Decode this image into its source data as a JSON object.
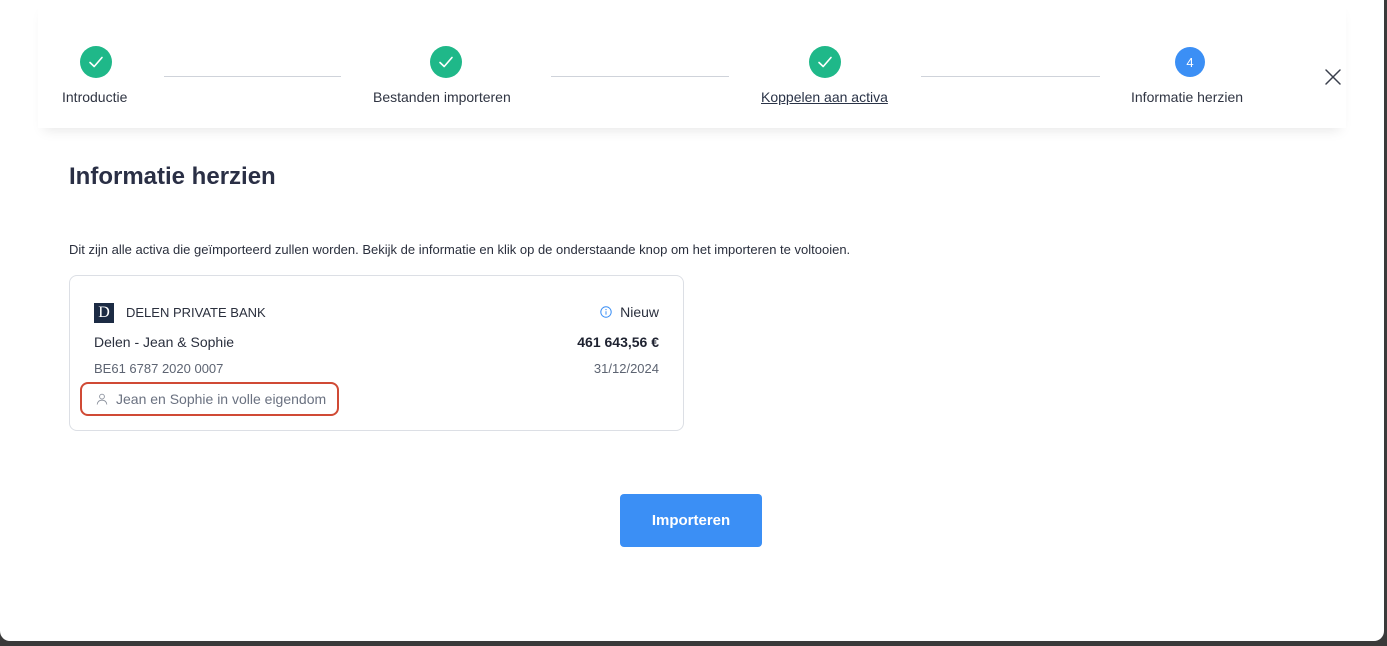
{
  "stepper": {
    "steps": [
      {
        "label": "Introductie",
        "status": "done"
      },
      {
        "label": "Bestanden importeren",
        "status": "done"
      },
      {
        "label": "Koppelen aan activa",
        "status": "done"
      },
      {
        "label": "Informatie herzien",
        "status": "active",
        "number": "4"
      }
    ],
    "close_icon": "close-icon"
  },
  "page": {
    "title": "Informatie herzien",
    "description": "Dit zijn alle activa die geïmporteerd zullen worden. Bekijk de informatie en klik op de onderstaande knop om het importeren te voltooien."
  },
  "asset_card": {
    "bank_logo_letter": "D",
    "bank_name": "DELEN PRIVATE BANK",
    "status": "Nieuw",
    "account_name": "Delen - Jean & Sophie",
    "amount": "461 643,56 €",
    "iban": "BE61 6787 2020 0007",
    "date": "31/12/2024",
    "ownership": "Jean en Sophie in volle eigendom"
  },
  "actions": {
    "import_label": "Importeren"
  },
  "colors": {
    "done": "#1fb889",
    "active": "#3b8ff5",
    "highlight": "#d04a35"
  }
}
